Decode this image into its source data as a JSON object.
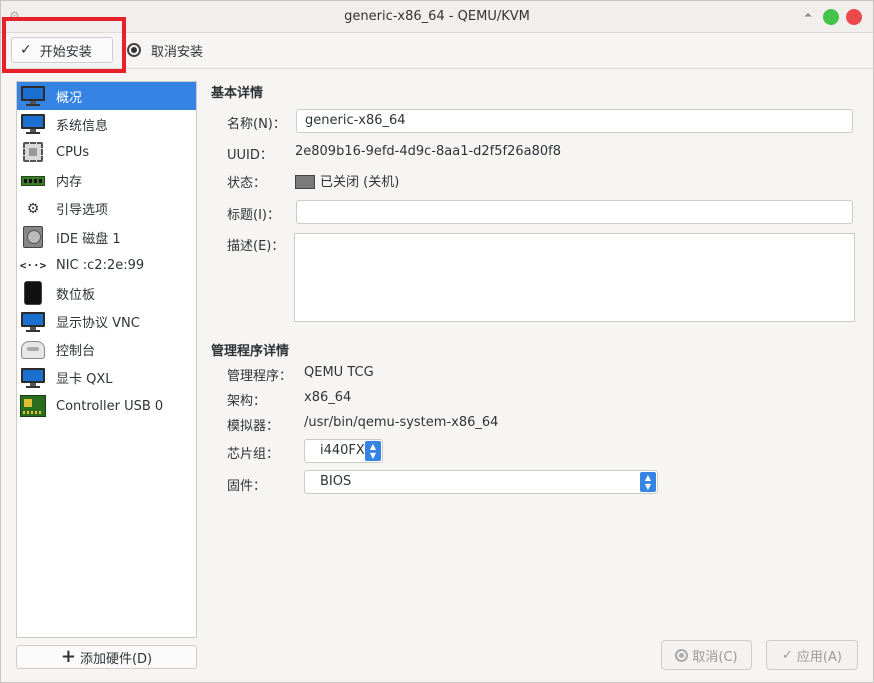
{
  "window": {
    "title": "generic-x86_64 - QEMU/KVM"
  },
  "toolbar": {
    "start_install": "开始安装",
    "cancel_install": "取消安装"
  },
  "sidebar": {
    "items": [
      {
        "label": "概况",
        "icon": "monitor-icon",
        "active": true
      },
      {
        "label": "系统信息",
        "icon": "monitor-icon"
      },
      {
        "label": "CPUs",
        "icon": "cpu-icon"
      },
      {
        "label": "内存",
        "icon": "memory-icon"
      },
      {
        "label": "引导选项",
        "icon": "gears-icon"
      },
      {
        "label": "IDE 磁盘 1",
        "icon": "disk-icon"
      },
      {
        "label": "NIC :c2:2e:99",
        "icon": "network-icon"
      },
      {
        "label": "数位板",
        "icon": "tablet-icon"
      },
      {
        "label": "显示协议 VNC",
        "icon": "monitor-icon"
      },
      {
        "label": "控制台",
        "icon": "console-icon"
      },
      {
        "label": "显卡 QXL",
        "icon": "monitor-icon"
      },
      {
        "label": "Controller USB 0",
        "icon": "usb-controller-icon"
      }
    ],
    "add_hardware": "添加硬件(D)"
  },
  "basic": {
    "title": "基本详情",
    "name_label": "名称(N)：",
    "name_value": "generic-x86_64",
    "uuid_label": "UUID：",
    "uuid_value": "2e809b16-9efd-4d9c-8aa1-d2f5f26a80f8",
    "state_label": "状态：",
    "state_value": "已关闭 (关机)",
    "title_label": "标题(I)：",
    "title_value": "",
    "desc_label": "描述(E)：",
    "desc_value": ""
  },
  "hypervisor": {
    "title": "管理程序详情",
    "hv_label": "管理程序：",
    "hv_value": "QEMU TCG",
    "arch_label": "架构：",
    "arch_value": "x86_64",
    "emu_label": "模拟器：",
    "emu_value": "/usr/bin/qemu-system-x86_64",
    "chipset_label": "芯片组：",
    "chipset_value": "i440FX",
    "firmware_label": "固件：",
    "firmware_value": "BIOS"
  },
  "buttons": {
    "cancel": "取消(C)",
    "apply": "应用(A)"
  },
  "colors": {
    "accent": "#3584e4",
    "highlight_box": "#e8202a",
    "close": "#ea4a4a",
    "maximize": "#45c24a"
  }
}
